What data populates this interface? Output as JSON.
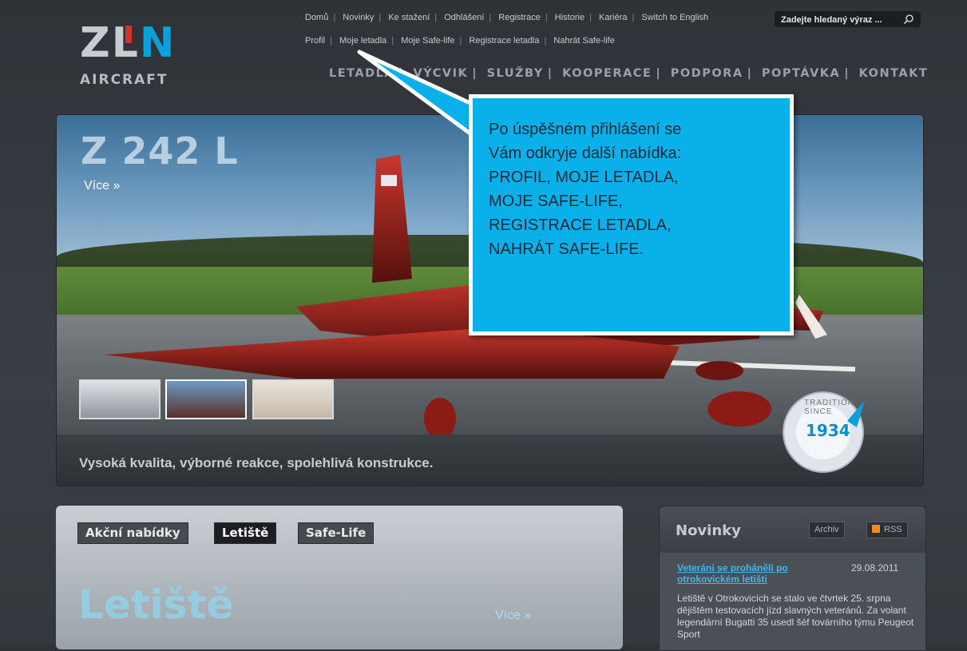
{
  "logo": {
    "mark": "ZLIN",
    "subtitle": "AIRCRAFT"
  },
  "top_links": [
    "Domů",
    "Novinky",
    "Ke stažení",
    "Odhlášení",
    "Registrace",
    "Historie",
    "Kariéra",
    "Switch to English"
  ],
  "search": {
    "placeholder": "Zadejte hledaný výraz ..."
  },
  "sub_links": [
    "Profil",
    "Moje letadla",
    "Moje Safe-life",
    "Registrace letadla",
    "Nahrát Safe-life"
  ],
  "main_nav": [
    "LETADLA",
    "VÝCVIK",
    "SLUŽBY",
    "KOOPERACE",
    "PODPORA",
    "POPTÁVKA",
    "KONTAKT"
  ],
  "hero": {
    "title": "Z 242 L",
    "more": "Více »",
    "caption": "Vysoká kvalita, výborné reakce, spolehlivá konstrukce.",
    "badge_top": "TRADITION SINCE",
    "badge_year": "1934"
  },
  "callout": {
    "lines": [
      "Po úspěšném přihlášení se",
      "Vám odkryje další nabídka:",
      "PROFIL, MOJE LETADLA,",
      "MOJE SAFE-LIFE,",
      "REGISTRACE LETADLA,",
      "NAHRÁT SAFE-LIFE."
    ]
  },
  "panel": {
    "tabs": [
      "Akční nabídky",
      "Letiště",
      "Safe-Life"
    ],
    "active_tab": "Letiště",
    "title": "Letiště",
    "more": "Více »"
  },
  "news": {
    "title": "Novinky",
    "archive": "Archiv",
    "rss": "RSS",
    "item": {
      "headline": "Veteráni se proháněli po otrokovickém letišti",
      "date": "29.08.2011",
      "text": "Letiště v Otrokovicích se stalo ve čtvrtek 25. srpna dějištěm testovacích jízd slavných veteránů. Za volant legendární Bugatti 35 usedl šéf továrního týmu Peugeot Sport"
    }
  },
  "colors": {
    "accent": "#0aa0d8",
    "callout": "#0ab0ea",
    "link": "#3fb8ef"
  }
}
